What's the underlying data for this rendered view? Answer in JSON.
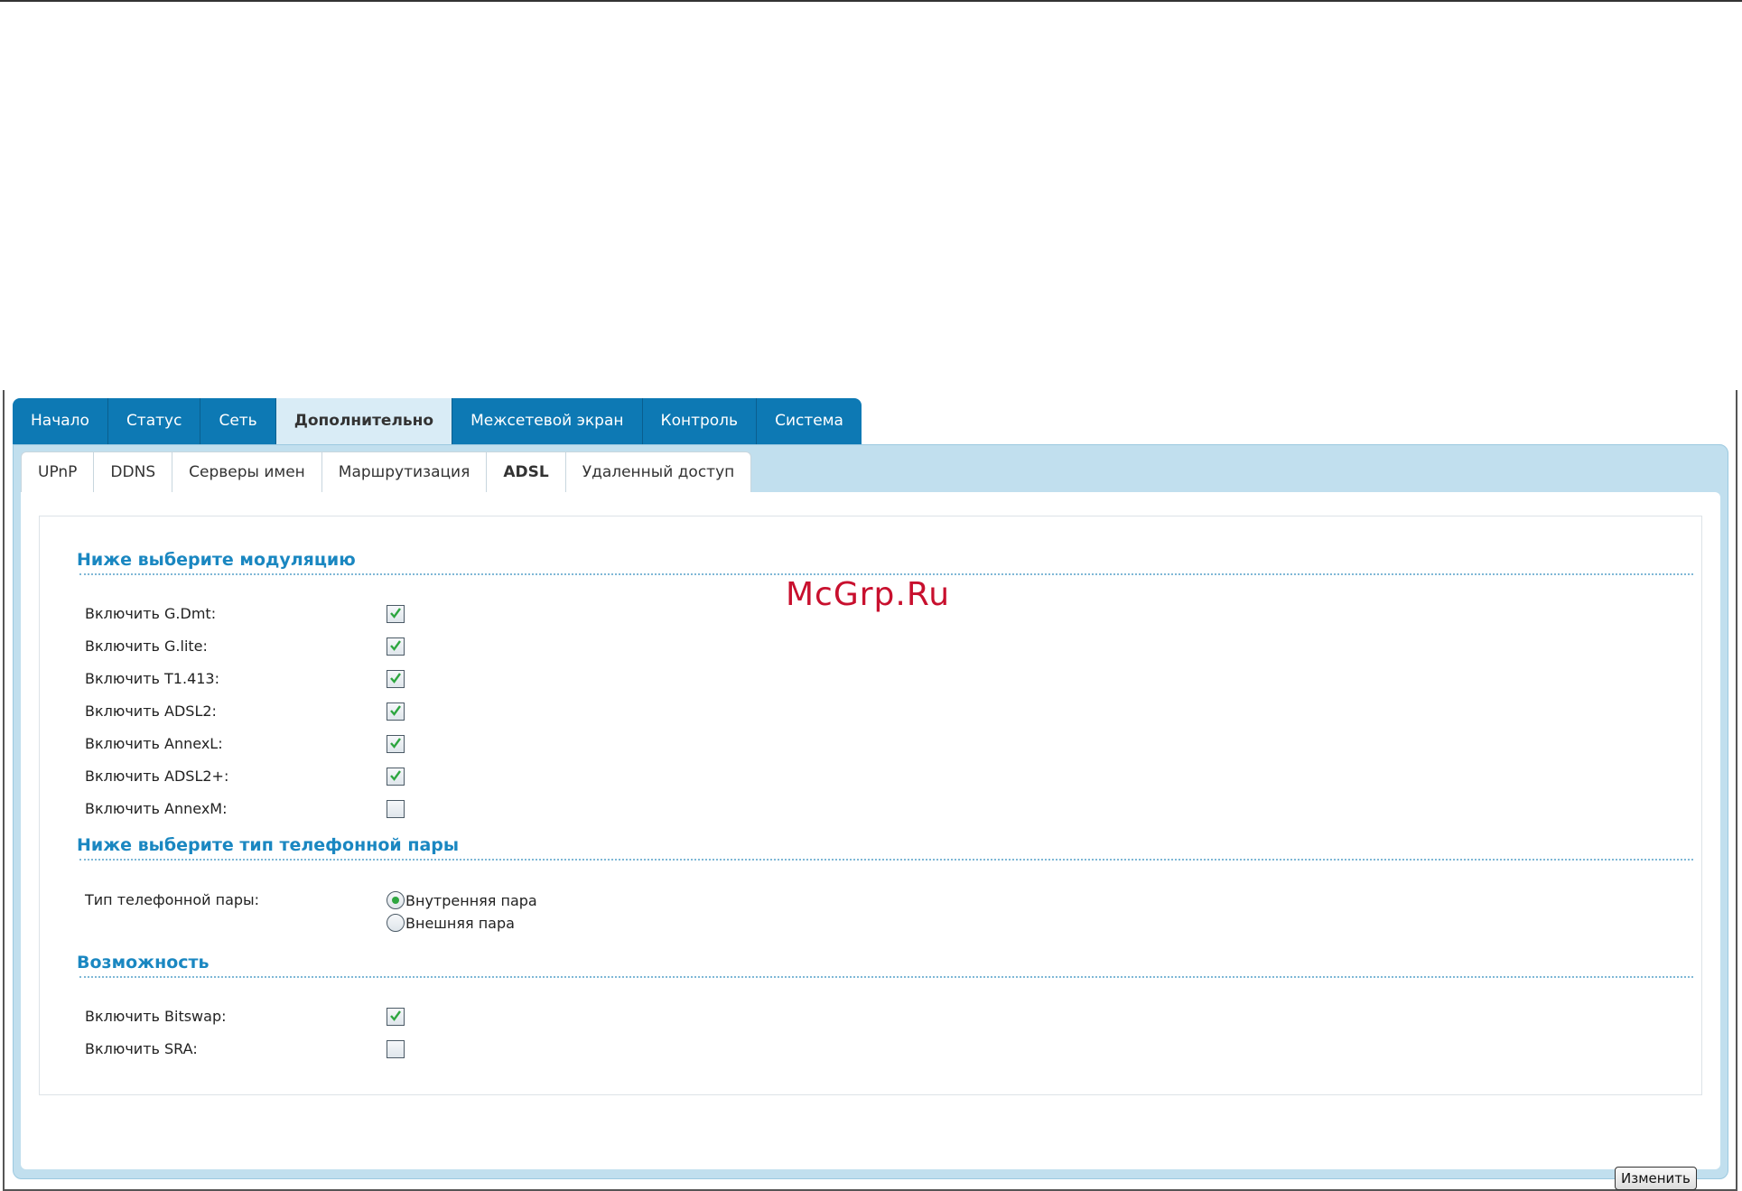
{
  "main_tabs": [
    {
      "label": "Начало",
      "active": false
    },
    {
      "label": "Статус",
      "active": false
    },
    {
      "label": "Сеть",
      "active": false
    },
    {
      "label": "Дополнительно",
      "active": true
    },
    {
      "label": "Межсетевой экран",
      "active": false
    },
    {
      "label": "Контроль",
      "active": false
    },
    {
      "label": "Система",
      "active": false
    }
  ],
  "sub_tabs": [
    {
      "label": "UPnP",
      "active": false
    },
    {
      "label": "DDNS",
      "active": false
    },
    {
      "label": "Серверы имен",
      "active": false
    },
    {
      "label": "Маршрутизация",
      "active": false
    },
    {
      "label": "ADSL",
      "active": true
    },
    {
      "label": "Удаленный доступ",
      "active": false
    }
  ],
  "modulation": {
    "title": "Ниже выберите модуляцию",
    "options": [
      {
        "label": "Включить G.Dmt:",
        "checked": true
      },
      {
        "label": "Включить G.lite:",
        "checked": true
      },
      {
        "label": "Включить T1.413:",
        "checked": true
      },
      {
        "label": "Включить ADSL2:",
        "checked": true
      },
      {
        "label": "Включить AnnexL:",
        "checked": true
      },
      {
        "label": "Включить ADSL2+:",
        "checked": true
      },
      {
        "label": "Включить AnnexM:",
        "checked": false
      }
    ]
  },
  "line_type": {
    "title": "Ниже выберите тип телефонной пары",
    "label": "Тип телефонной пары:",
    "options": [
      {
        "label": "Внутренняя пара",
        "selected": true
      },
      {
        "label": "Внешняя пара",
        "selected": false
      }
    ]
  },
  "capability": {
    "title": "Возможность",
    "options": [
      {
        "label": "Включить Bitswap:",
        "checked": true
      },
      {
        "label": "Включить SRA:",
        "checked": false
      }
    ]
  },
  "submit_label": "Изменить",
  "watermark": "McGrp.Ru",
  "colors": {
    "tab_blue": "#0d79b4",
    "panel_blue": "#c1dfee",
    "section_title": "#1a87c1",
    "check_green": "#2ea640"
  }
}
